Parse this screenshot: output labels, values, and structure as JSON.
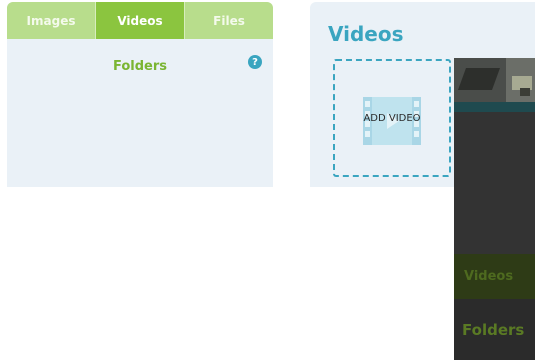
{
  "media_panel": {
    "tabs": [
      {
        "label": "Images",
        "active": false
      },
      {
        "label": "Videos",
        "active": true
      },
      {
        "label": "Files",
        "active": false
      }
    ],
    "folders_title": "Folders",
    "help_icon": "?"
  },
  "videos_panel": {
    "title": "Videos",
    "add_video_label": "ADD VIDEO"
  },
  "overlay": {
    "videos_label": "Videos",
    "folders_label": "Folders"
  },
  "colors": {
    "accent_green": "#8bc53f",
    "accent_blue": "#3aa5c0",
    "panel_bg": "#eaf1f7"
  }
}
